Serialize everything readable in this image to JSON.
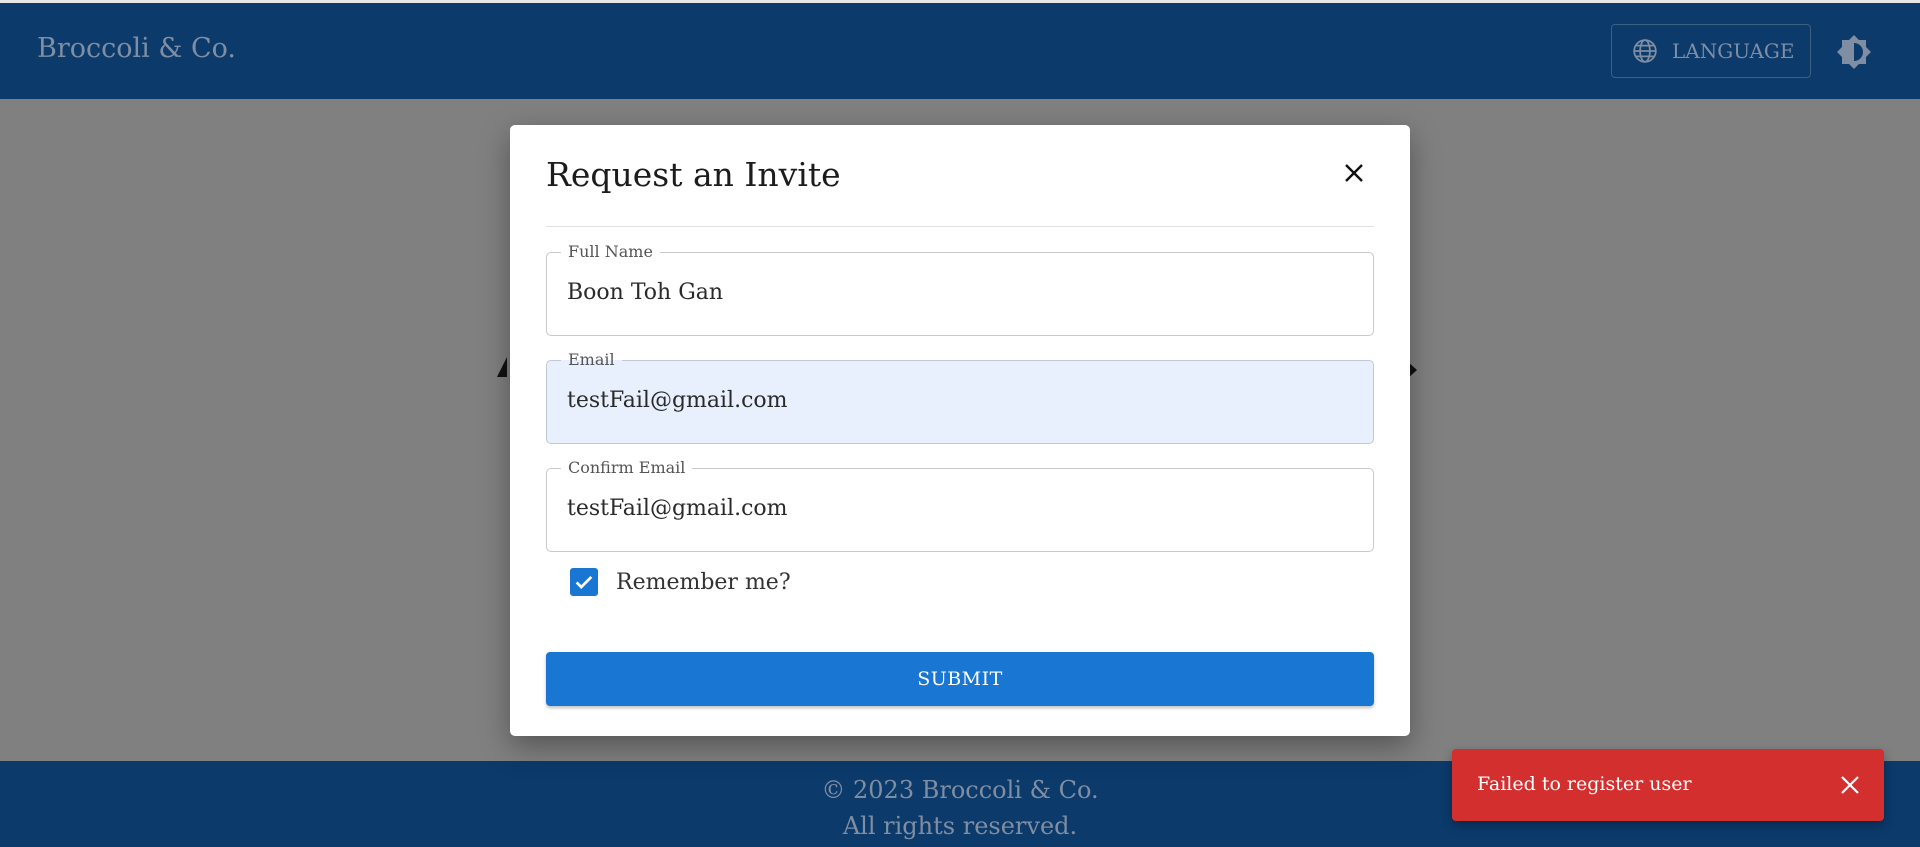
{
  "header": {
    "brand": "Broccoli & Co.",
    "language_label": "LANGUAGE",
    "language_icon": "globe-icon",
    "theme_icon": "brightness-icon"
  },
  "dialog": {
    "title": "Request an Invite",
    "fields": [
      {
        "label": "Full Name",
        "value": "Boon Toh Gan"
      },
      {
        "label": "Email",
        "value": "testFail@gmail.com"
      },
      {
        "label": "Confirm Email",
        "value": "testFail@gmail.com"
      }
    ],
    "remember_label": "Remember me?",
    "remember_checked": true,
    "submit_label": "SUBMIT"
  },
  "footer": {
    "line1": "© 2023 Broccoli & Co.",
    "line2": "All rights reserved."
  },
  "toast": {
    "message": "Failed to register user"
  },
  "colors": {
    "header_bg": "#0b3a6b",
    "primary": "#1976d2",
    "error": "#d32f2f",
    "autofill_bg": "#e8f0fe"
  }
}
